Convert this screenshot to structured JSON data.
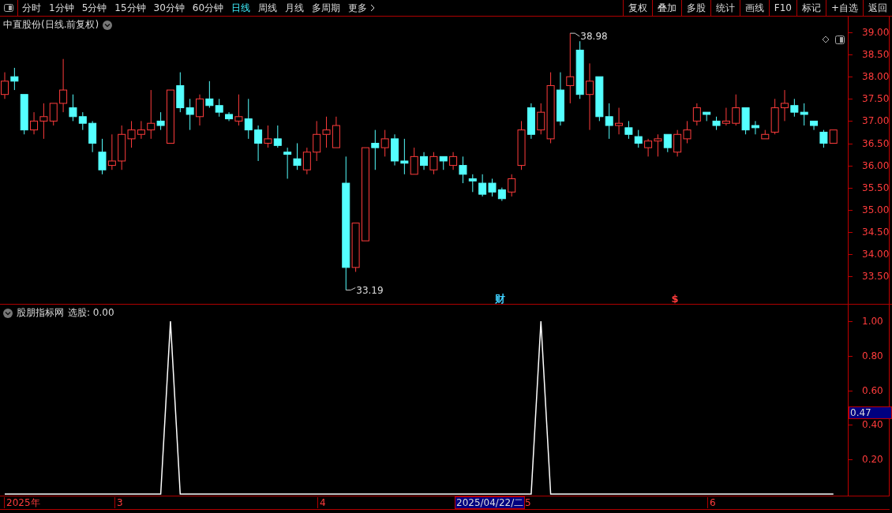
{
  "toolbar": {
    "periods": [
      {
        "label": "分时",
        "selected": false
      },
      {
        "label": "1分钟",
        "selected": false
      },
      {
        "label": "5分钟",
        "selected": false
      },
      {
        "label": "15分钟",
        "selected": false
      },
      {
        "label": "30分钟",
        "selected": false
      },
      {
        "label": "60分钟",
        "selected": false
      },
      {
        "label": "日线",
        "selected": true
      },
      {
        "label": "周线",
        "selected": false
      },
      {
        "label": "月线",
        "selected": false
      },
      {
        "label": "多周期",
        "selected": false
      },
      {
        "label": "更多",
        "selected": false
      }
    ],
    "actions": [
      "复权",
      "叠加",
      "多股",
      "统计",
      "画线",
      "F10",
      "标记",
      "+自选",
      "返回"
    ]
  },
  "main_chart": {
    "title": "中直股份(日线.前复权)",
    "high_label": "38.98",
    "low_label": "33.19",
    "markers": [
      {
        "text": "财",
        "color": "#3fd0ff"
      },
      {
        "text": "$",
        "color": "#ff3c3c"
      }
    ],
    "chart_data": {
      "type": "candlestick",
      "ylim": [
        32.879,
        39.356
      ],
      "yticks": [
        {
          "value": 39,
          "label": "39.00"
        },
        {
          "value": 38.5,
          "label": "38.50"
        },
        {
          "value": 38,
          "label": "38.00"
        },
        {
          "value": 37.5,
          "label": "37.50"
        },
        {
          "value": 37,
          "label": "37.00"
        },
        {
          "value": 36.5,
          "label": "36.50"
        },
        {
          "value": 36,
          "label": "36.00"
        },
        {
          "value": 35.5,
          "label": "35.50"
        },
        {
          "value": 35,
          "label": "35.00"
        },
        {
          "value": 34.5,
          "label": "34.50"
        },
        {
          "value": 34,
          "label": "34.00"
        },
        {
          "value": 33.5,
          "label": "33.50"
        }
      ],
      "ohlc": [
        [
          37.6,
          38.1,
          37.5,
          37.9
        ],
        [
          38.0,
          38.2,
          37.7,
          37.9
        ],
        [
          37.6,
          37.6,
          36.7,
          36.8
        ],
        [
          36.8,
          37.2,
          36.7,
          37.0
        ],
        [
          37.0,
          37.4,
          36.6,
          37.1
        ],
        [
          37.0,
          37.4,
          36.9,
          37.4
        ],
        [
          37.4,
          38.4,
          37.2,
          37.7
        ],
        [
          37.3,
          37.6,
          37.0,
          37.1
        ],
        [
          37.1,
          37.2,
          36.8,
          36.95
        ],
        [
          36.95,
          37.0,
          36.3,
          36.5
        ],
        [
          36.3,
          36.6,
          35.8,
          35.9
        ],
        [
          36.0,
          36.7,
          35.9,
          36.1
        ],
        [
          36.1,
          36.9,
          35.9,
          36.7
        ],
        [
          36.6,
          37.0,
          36.4,
          36.8
        ],
        [
          36.7,
          37.0,
          36.6,
          36.8
        ],
        [
          36.8,
          37.7,
          36.6,
          36.95
        ],
        [
          37.0,
          37.2,
          36.8,
          36.9
        ],
        [
          36.5,
          37.7,
          36.5,
          37.7
        ],
        [
          37.8,
          38.1,
          37.2,
          37.3
        ],
        [
          37.3,
          37.5,
          36.8,
          37.15
        ],
        [
          37.1,
          37.6,
          36.9,
          37.5
        ],
        [
          37.5,
          37.9,
          37.3,
          37.35
        ],
        [
          37.35,
          37.5,
          37.1,
          37.2
        ],
        [
          37.15,
          37.2,
          37.0,
          37.05
        ],
        [
          37.0,
          37.6,
          36.9,
          37.1
        ],
        [
          37.05,
          37.5,
          36.6,
          36.8
        ],
        [
          36.8,
          36.9,
          36.1,
          36.5
        ],
        [
          36.5,
          36.9,
          36.4,
          36.6
        ],
        [
          36.6,
          36.9,
          36.4,
          36.45
        ],
        [
          36.3,
          36.4,
          35.7,
          36.25
        ],
        [
          36.15,
          36.5,
          35.9,
          36.0
        ],
        [
          35.9,
          36.4,
          35.8,
          36.3
        ],
        [
          36.3,
          37.0,
          36.1,
          36.7
        ],
        [
          36.7,
          37.1,
          36.4,
          36.8
        ],
        [
          36.4,
          37.1,
          36.4,
          36.9
        ],
        [
          35.6,
          36.2,
          33.19,
          33.7
        ],
        [
          33.7,
          34.7,
          33.6,
          34.7
        ],
        [
          34.3,
          36.4,
          34.3,
          36.4
        ],
        [
          36.5,
          36.8,
          35.9,
          36.4
        ],
        [
          36.4,
          36.8,
          36.2,
          36.6
        ],
        [
          36.6,
          36.7,
          36.0,
          36.1
        ],
        [
          36.1,
          36.6,
          35.8,
          36.05
        ],
        [
          35.8,
          36.4,
          35.8,
          36.2
        ],
        [
          36.2,
          36.3,
          35.9,
          36.0
        ],
        [
          35.9,
          36.3,
          35.8,
          36.2
        ],
        [
          36.2,
          36.2,
          35.9,
          36.1
        ],
        [
          36.0,
          36.3,
          35.9,
          36.2
        ],
        [
          36.0,
          36.2,
          35.6,
          35.8
        ],
        [
          35.7,
          35.8,
          35.4,
          35.65
        ],
        [
          35.6,
          35.8,
          35.3,
          35.35
        ],
        [
          35.6,
          35.7,
          35.3,
          35.4
        ],
        [
          35.45,
          35.5,
          35.2,
          35.25
        ],
        [
          35.4,
          35.8,
          35.3,
          35.7
        ],
        [
          36.0,
          37.0,
          35.9,
          36.8
        ],
        [
          37.3,
          37.4,
          36.6,
          36.7
        ],
        [
          36.8,
          37.4,
          36.7,
          37.2
        ],
        [
          36.6,
          38.1,
          36.5,
          37.8
        ],
        [
          37.7,
          38.1,
          36.9,
          37.0
        ],
        [
          37.8,
          38.98,
          37.4,
          38.0
        ],
        [
          38.6,
          38.8,
          37.5,
          37.6
        ],
        [
          37.6,
          38.3,
          36.8,
          37.9
        ],
        [
          38.0,
          38.0,
          37.0,
          37.1
        ],
        [
          37.1,
          37.4,
          36.6,
          36.9
        ],
        [
          36.9,
          37.3,
          36.7,
          36.95
        ],
        [
          36.85,
          37.0,
          36.6,
          36.7
        ],
        [
          36.65,
          36.8,
          36.4,
          36.5
        ],
        [
          36.4,
          36.6,
          36.2,
          36.55
        ],
        [
          36.55,
          36.7,
          36.2,
          36.6
        ],
        [
          36.7,
          36.7,
          36.3,
          36.4
        ],
        [
          36.3,
          36.8,
          36.2,
          36.7
        ],
        [
          36.6,
          37.0,
          36.5,
          36.8
        ],
        [
          37.0,
          37.4,
          36.9,
          37.3
        ],
        [
          37.2,
          37.2,
          37.0,
          37.15
        ],
        [
          37.0,
          37.1,
          36.8,
          36.9
        ],
        [
          36.95,
          37.3,
          36.9,
          37.0
        ],
        [
          36.95,
          37.6,
          36.9,
          37.3
        ],
        [
          37.3,
          37.3,
          36.7,
          36.8
        ],
        [
          36.9,
          37.0,
          36.7,
          36.85
        ],
        [
          36.6,
          36.8,
          36.6,
          36.7
        ],
        [
          36.75,
          37.5,
          36.7,
          37.3
        ],
        [
          37.3,
          37.7,
          37.0,
          37.4
        ],
        [
          37.35,
          37.5,
          37.1,
          37.2
        ],
        [
          37.2,
          37.4,
          36.9,
          37.15
        ],
        [
          37.0,
          37.0,
          36.8,
          36.9
        ],
        [
          36.75,
          36.8,
          36.4,
          36.5
        ],
        [
          36.5,
          36.8,
          36.5,
          36.8
        ]
      ]
    }
  },
  "indicator": {
    "title": "股朋指标网",
    "reading": "选股: 0.00",
    "cursor_value": "0.47",
    "chart_data": {
      "type": "line",
      "ylim": [
        0,
        1.096
      ],
      "yticks": [
        {
          "value": 1,
          "label": "1.00"
        },
        {
          "value": 0.8,
          "label": "0.80"
        },
        {
          "value": 0.6,
          "label": "0.60"
        },
        {
          "value": 0.4,
          "label": "0.40"
        },
        {
          "value": 0.2,
          "label": "0.20"
        }
      ],
      "series": [
        {
          "color": "#ffffff",
          "values": [
            0,
            0,
            0,
            0,
            0,
            0,
            0,
            0,
            0,
            0,
            0,
            0,
            0,
            0,
            0,
            0,
            0,
            1,
            0,
            0,
            0,
            0,
            0,
            0,
            0,
            0,
            0,
            0,
            0,
            0,
            0,
            0,
            0,
            0,
            0,
            0,
            0,
            0,
            0,
            0,
            0,
            0,
            0,
            0,
            0,
            0,
            0,
            0,
            0,
            0,
            0,
            0,
            0,
            0,
            0,
            1,
            0,
            0,
            0,
            0,
            0,
            0,
            0,
            0,
            0,
            0,
            0,
            0,
            0,
            0,
            0,
            0,
            0,
            0,
            0,
            0,
            0,
            0,
            0,
            0,
            0,
            0,
            0,
            0,
            0,
            0
          ]
        }
      ]
    }
  },
  "time_axis": {
    "labels": [
      "2025年",
      "3",
      "4",
      "5",
      "6"
    ],
    "cursor_date": "2025/04/22/二"
  }
}
